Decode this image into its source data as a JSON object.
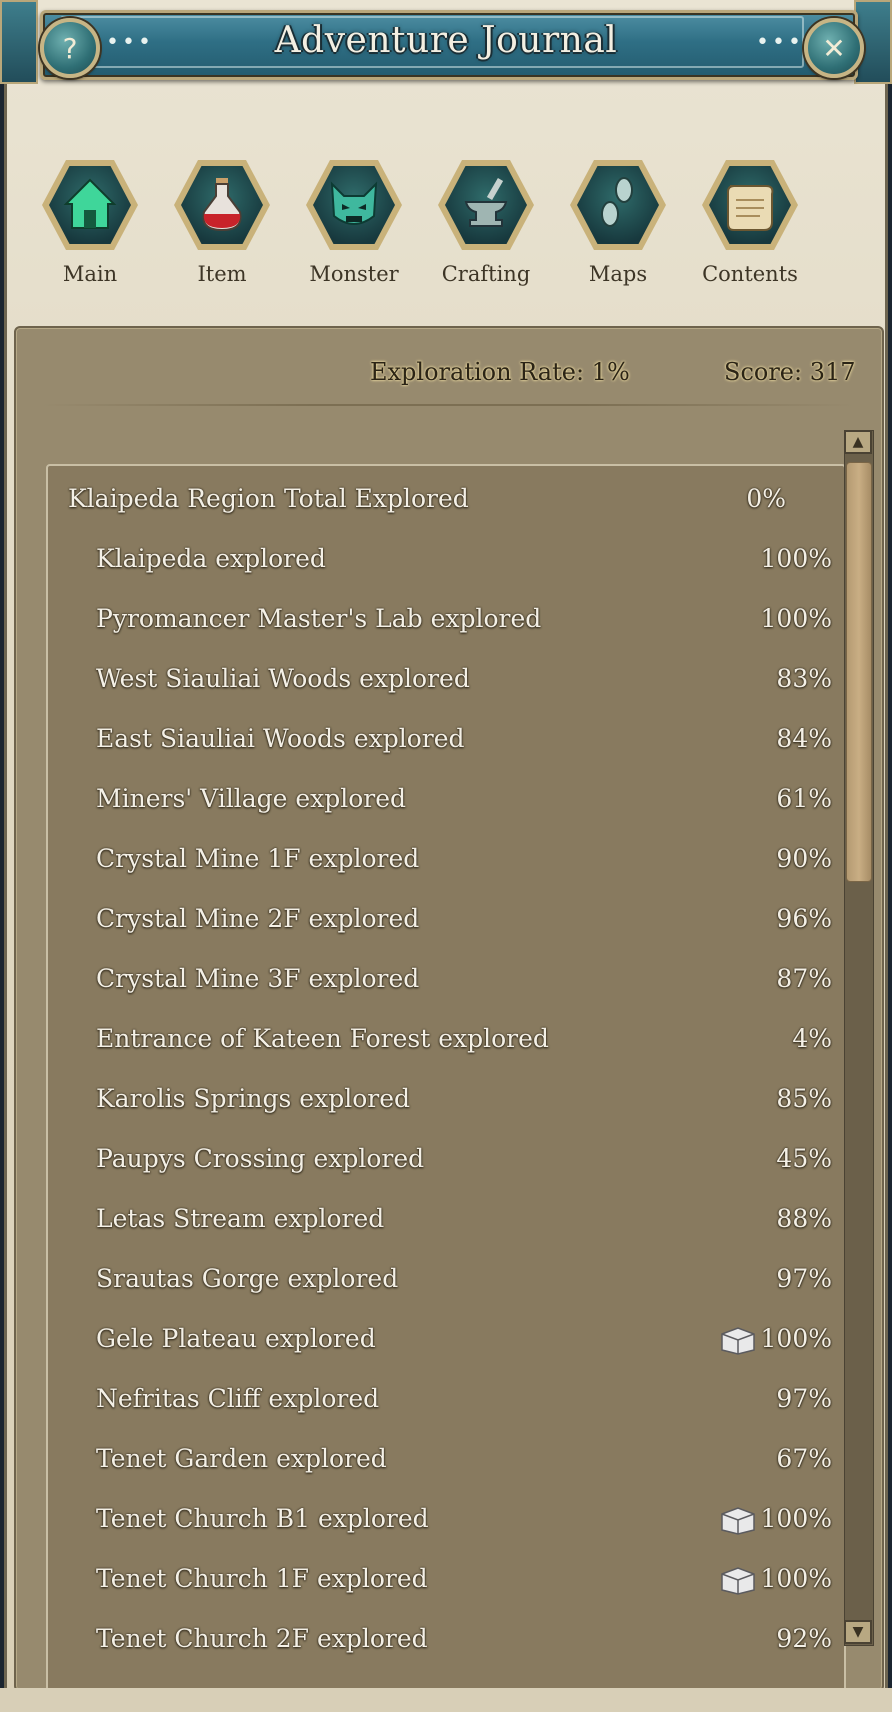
{
  "title": "Adventure Journal",
  "help_glyph": "?",
  "close_glyph": "✕",
  "nav": [
    {
      "label": "Main",
      "icon": "house-icon"
    },
    {
      "label": "Item",
      "icon": "potion-icon"
    },
    {
      "label": "Monster",
      "icon": "monster-icon"
    },
    {
      "label": "Crafting",
      "icon": "anvil-icon"
    },
    {
      "label": "Maps",
      "icon": "footprints-icon"
    },
    {
      "label": "Contents",
      "icon": "scroll-icon"
    }
  ],
  "stats": {
    "exploration_rate": "Exploration Rate: 1%",
    "score": "Score: 317"
  },
  "region": {
    "name": "Klaipeda Region",
    "total_label": "Total Explored",
    "total_pct": "0%"
  },
  "areas": [
    {
      "name": "Klaipeda explored",
      "pct": "100%",
      "chest": false
    },
    {
      "name": "Pyromancer Master's Lab explored",
      "pct": "100%",
      "chest": false
    },
    {
      "name": "West Siauliai Woods explored",
      "pct": "83%",
      "chest": false
    },
    {
      "name": "East Siauliai Woods explored",
      "pct": "84%",
      "chest": false
    },
    {
      "name": "Miners' Village explored",
      "pct": "61%",
      "chest": false
    },
    {
      "name": "Crystal Mine 1F explored",
      "pct": "90%",
      "chest": false
    },
    {
      "name": "Crystal Mine 2F explored",
      "pct": "96%",
      "chest": false
    },
    {
      "name": "Crystal Mine 3F explored",
      "pct": "87%",
      "chest": false
    },
    {
      "name": "Entrance of Kateen Forest explored",
      "pct": "4%",
      "chest": false
    },
    {
      "name": "Karolis Springs explored",
      "pct": "85%",
      "chest": false
    },
    {
      "name": "Paupys Crossing explored",
      "pct": "45%",
      "chest": false
    },
    {
      "name": "Letas Stream explored",
      "pct": "88%",
      "chest": false
    },
    {
      "name": "Srautas Gorge explored",
      "pct": "97%",
      "chest": false
    },
    {
      "name": "Gele Plateau explored",
      "pct": "100%",
      "chest": true
    },
    {
      "name": "Nefritas Cliff explored",
      "pct": "97%",
      "chest": false
    },
    {
      "name": "Tenet Garden explored",
      "pct": "67%",
      "chest": false
    },
    {
      "name": "Tenet Church B1 explored",
      "pct": "100%",
      "chest": true
    },
    {
      "name": "Tenet Church 1F explored",
      "pct": "100%",
      "chest": true
    },
    {
      "name": "Tenet Church 2F explored",
      "pct": "92%",
      "chest": false
    }
  ],
  "colors": {
    "title_bar": "#2f6f85",
    "panel": "#978a6e",
    "list_bg": "#887a5f",
    "text": "#f4f0e6",
    "stat_text": "#2b2416"
  },
  "scroll": {
    "up_glyph": "▲",
    "down_glyph": "▼"
  }
}
